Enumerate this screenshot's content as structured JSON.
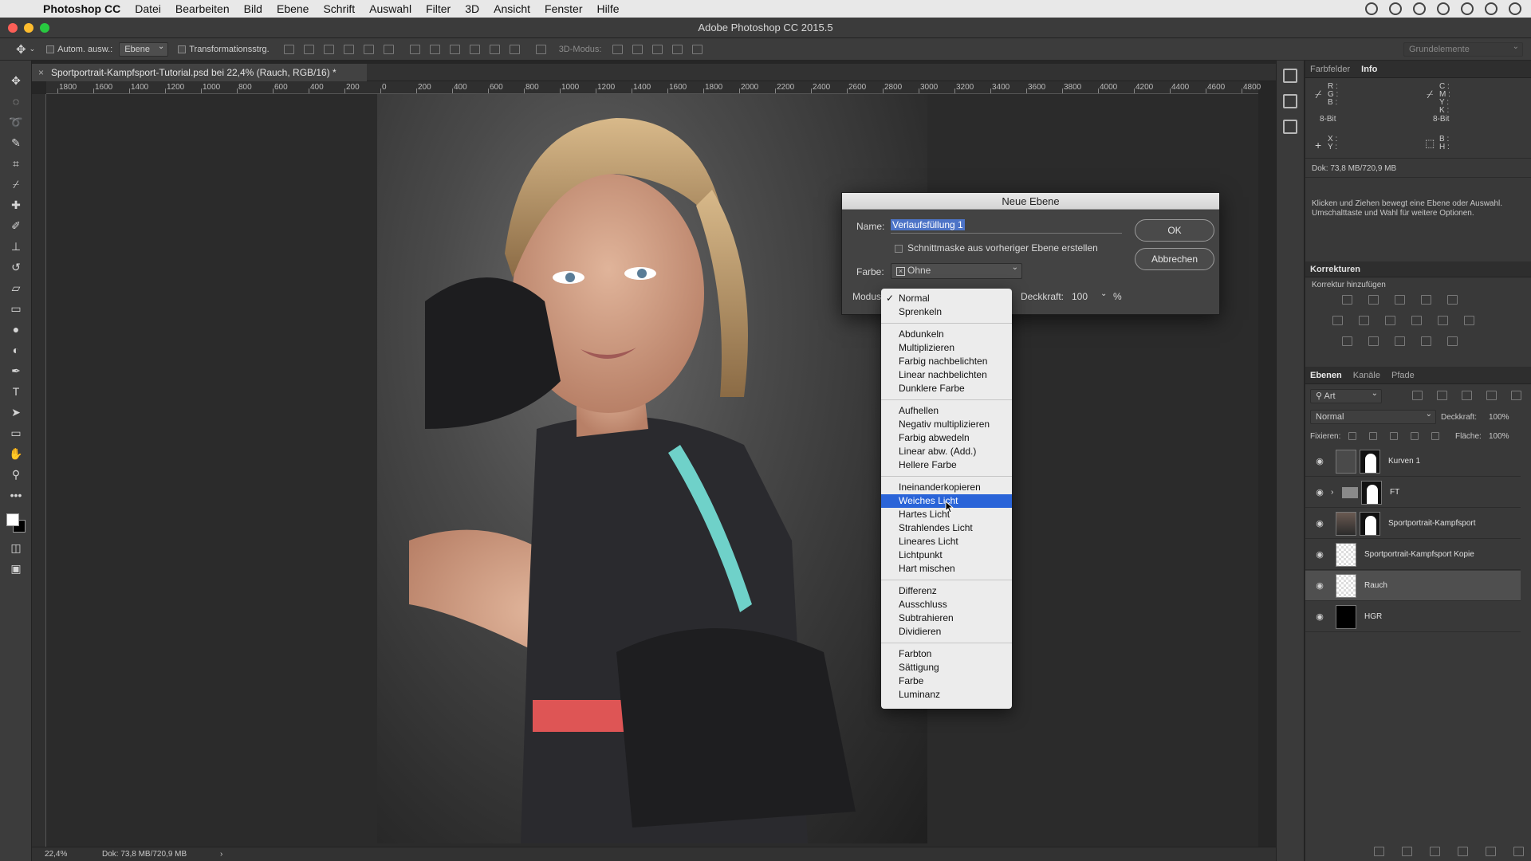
{
  "menubar": {
    "app_name": "Photoshop CC",
    "items": [
      "Datei",
      "Bearbeiten",
      "Bild",
      "Ebene",
      "Schrift",
      "Auswahl",
      "Filter",
      "3D",
      "Ansicht",
      "Fenster",
      "Hilfe"
    ]
  },
  "window": {
    "title": "Adobe Photoshop CC 2015.5"
  },
  "options_bar": {
    "auto_select_label": "Autom. ausw.:",
    "auto_select_value": "Ebene",
    "transform_label": "Transformationsstrg.",
    "mode3d_label": "3D-Modus:",
    "workspace": "Grundelemente"
  },
  "document": {
    "tab_title": "Sportportrait-Kampfsport-Tutorial.psd bei 22,4% (Rauch, RGB/16) *",
    "zoom": "22,4%",
    "doc_info": "Dok: 73,8 MB/720,9 MB"
  },
  "ruler": {
    "labels": [
      "1800",
      "1600",
      "1400",
      "1200",
      "1000",
      "800",
      "600",
      "400",
      "200",
      "0",
      "200",
      "400",
      "600",
      "800",
      "1000",
      "1200",
      "1400",
      "1600",
      "1800",
      "2000",
      "2200",
      "2400",
      "2600",
      "2800",
      "3000",
      "3200",
      "3400",
      "3600",
      "3800",
      "4000",
      "4200",
      "4400",
      "4600",
      "4800"
    ]
  },
  "info_panel": {
    "tabs": [
      "Farbfelder",
      "Info"
    ],
    "rgb_labels": [
      "R :",
      "G :",
      "B :"
    ],
    "cmyk_labels": [
      "C :",
      "M :",
      "Y :",
      "K :"
    ],
    "bit_left": "8-Bit",
    "bit_right": "8-Bit",
    "xy_labels": [
      "X :",
      "Y :"
    ],
    "bh_labels": [
      "B :",
      "H :"
    ],
    "doc": "Dok: 73,8 MB/720,9 MB",
    "hint": "Klicken und Ziehen bewegt eine Ebene oder Auswahl. Umschalttaste und Wahl für weitere Optionen."
  },
  "adjustments_panel": {
    "title": "Korrekturen",
    "subtitle": "Korrektur hinzufügen"
  },
  "layers_panel": {
    "tabs": [
      "Ebenen",
      "Kanäle",
      "Pfade"
    ],
    "filter": "Art",
    "blend_mode": "Normal",
    "opacity_label": "Deckkraft:",
    "opacity": "100%",
    "lock_label": "Fixieren:",
    "fill_label": "Fläche:",
    "fill": "100%",
    "layers": [
      {
        "name": "Kurven 1"
      },
      {
        "name": "FT"
      },
      {
        "name": "Sportportrait-Kampfsport"
      },
      {
        "name": "Sportportrait-Kampfsport Kopie"
      },
      {
        "name": "Rauch"
      },
      {
        "name": "HGR"
      }
    ]
  },
  "dialog": {
    "title": "Neue Ebene",
    "name_label": "Name:",
    "name_value": "Verlaufsfüllung 1",
    "clip_label": "Schnittmaske aus vorheriger Ebene erstellen",
    "color_label": "Farbe:",
    "color_value": "Ohne",
    "mode_label": "Modus:",
    "opacity_label": "Deckkraft:",
    "opacity_value": "100",
    "opacity_unit": "%",
    "ok": "OK",
    "cancel": "Abbrechen"
  },
  "blend_menu": {
    "groups": [
      [
        "Normal",
        "Sprenkeln"
      ],
      [
        "Abdunkeln",
        "Multiplizieren",
        "Farbig nachbelichten",
        "Linear nachbelichten",
        "Dunklere Farbe"
      ],
      [
        "Aufhellen",
        "Negativ multiplizieren",
        "Farbig abwedeln",
        "Linear abw. (Add.)",
        "Hellere Farbe"
      ],
      [
        "Ineinanderkopieren",
        "Weiches Licht",
        "Hartes Licht",
        "Strahlendes Licht",
        "Lineares Licht",
        "Lichtpunkt",
        "Hart mischen"
      ],
      [
        "Differenz",
        "Ausschluss",
        "Subtrahieren",
        "Dividieren"
      ],
      [
        "Farbton",
        "Sättigung",
        "Farbe",
        "Luminanz"
      ]
    ],
    "checked": "Normal",
    "highlighted": "Weiches Licht"
  },
  "colors": {
    "highlight": "#2a64d8",
    "panel": "#393939",
    "accent_teal": "#6fd1c9",
    "accent_coral": "#f25a5a"
  }
}
